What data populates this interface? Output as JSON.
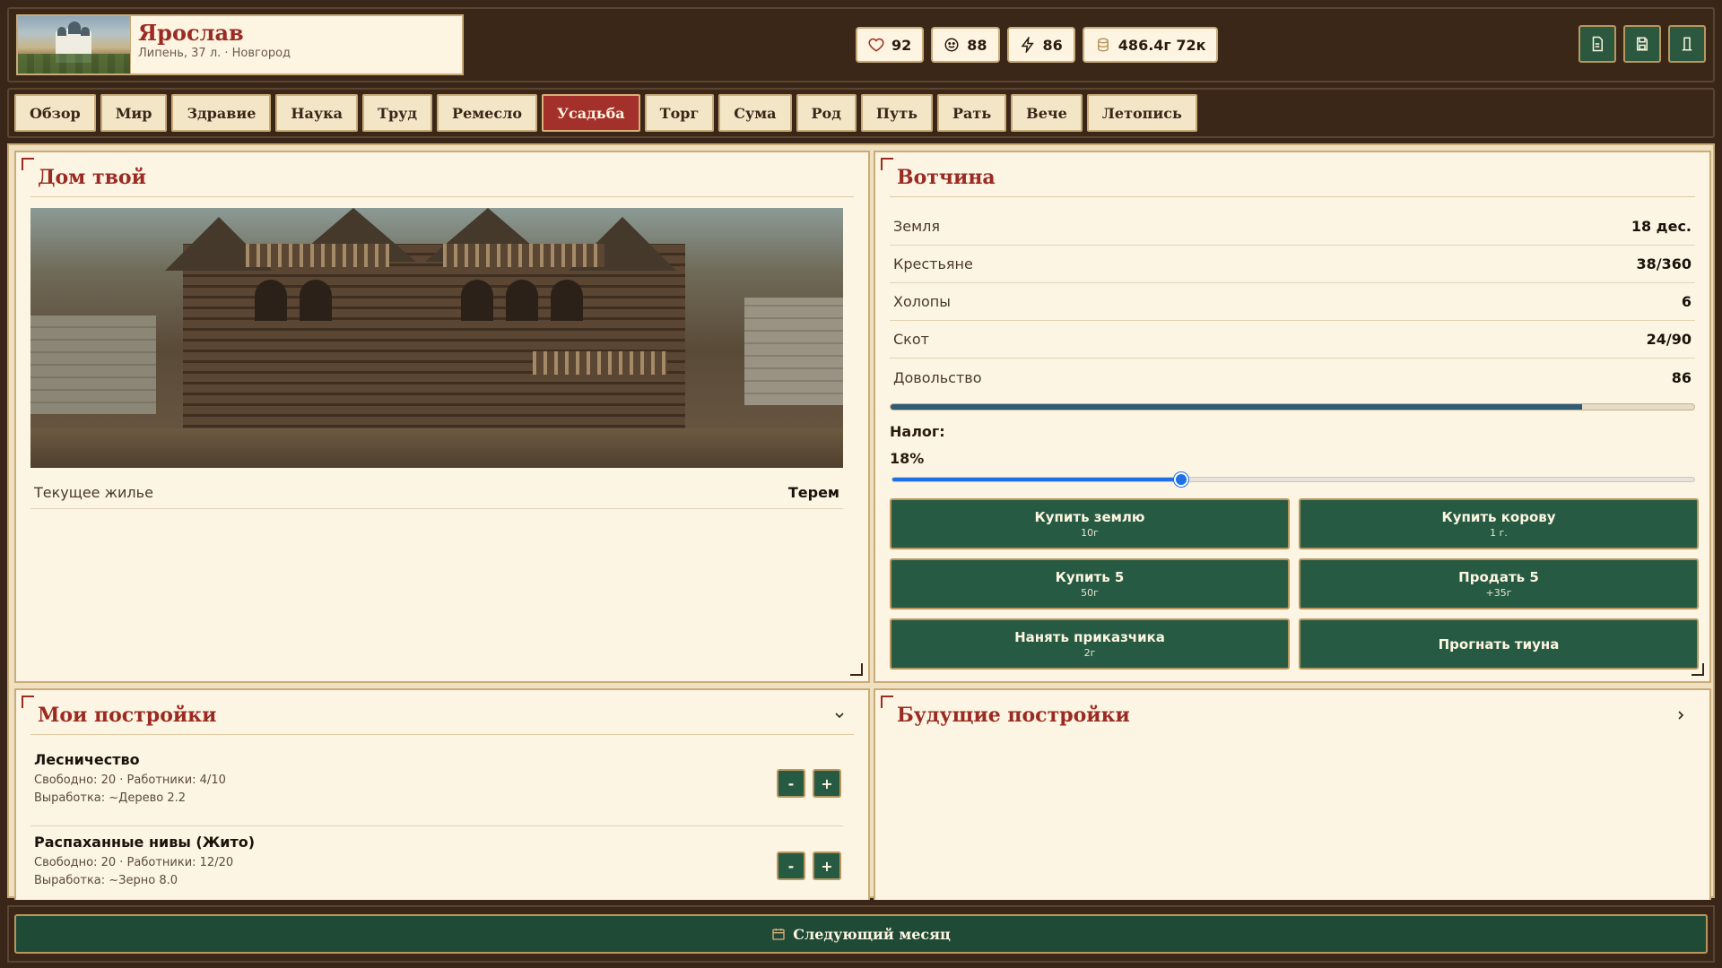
{
  "header": {
    "name": "Ярослав",
    "subtitle": "Липень, 37 л. · Новгород",
    "stats": {
      "health": "92",
      "mood": "88",
      "energy": "86",
      "money": "486.4г 72к"
    },
    "tools": [
      "document-icon",
      "save-icon",
      "bookmark-icon"
    ]
  },
  "tabs": [
    "Обзор",
    "Мир",
    "Здравие",
    "Наука",
    "Труд",
    "Ремесло",
    "Усадьба",
    "Торг",
    "Сума",
    "Род",
    "Путь",
    "Рать",
    "Вече",
    "Летопись"
  ],
  "active_tab": "Усадьба",
  "home": {
    "title": "Дом твой",
    "housing_label": "Текущее жилье",
    "housing_value": "Терем"
  },
  "estate": {
    "title": "Вотчина",
    "rows": [
      {
        "k": "Земля",
        "v": "18 дес."
      },
      {
        "k": "Крестьяне",
        "v": "38/360"
      },
      {
        "k": "Холопы",
        "v": "6"
      },
      {
        "k": "Скот",
        "v": "24/90"
      },
      {
        "k": "Довольство",
        "v": "86"
      }
    ],
    "satisfaction_fraction": 0.86,
    "tax_label": "Налог:",
    "tax_value": "18%",
    "tax_fraction": 0.36,
    "buttons": [
      {
        "label": "Купить землю",
        "cost": "10г"
      },
      {
        "label": "Купить корову",
        "cost": "1 г."
      },
      {
        "label": "Купить 5",
        "cost": "50г"
      },
      {
        "label": "Продать 5",
        "cost": "+35г"
      },
      {
        "label": "Нанять приказчика",
        "cost": "2г"
      },
      {
        "label": "Прогнать тиуна",
        "cost": ""
      }
    ]
  },
  "my_buildings": {
    "title": "Мои постройки",
    "items": [
      {
        "name": "Лесничество",
        "line1": "Свободно: 20 · Работники: 4/10",
        "line2": "Выработка: ~Дерево 2.2"
      },
      {
        "name": "Распаханные нивы (Жито)",
        "line1": "Свободно: 20 · Работники: 12/20",
        "line2": "Выработка: ~Зерно 8.0"
      }
    ],
    "minus": "-",
    "plus": "+"
  },
  "future_buildings": {
    "title": "Будущие постройки"
  },
  "footer": {
    "next_label": "Следующий месяц"
  },
  "colors": {
    "accent": "#9b2b22",
    "green": "#265a42",
    "wood": "#3b2718",
    "parchment": "#fdf5e3"
  }
}
